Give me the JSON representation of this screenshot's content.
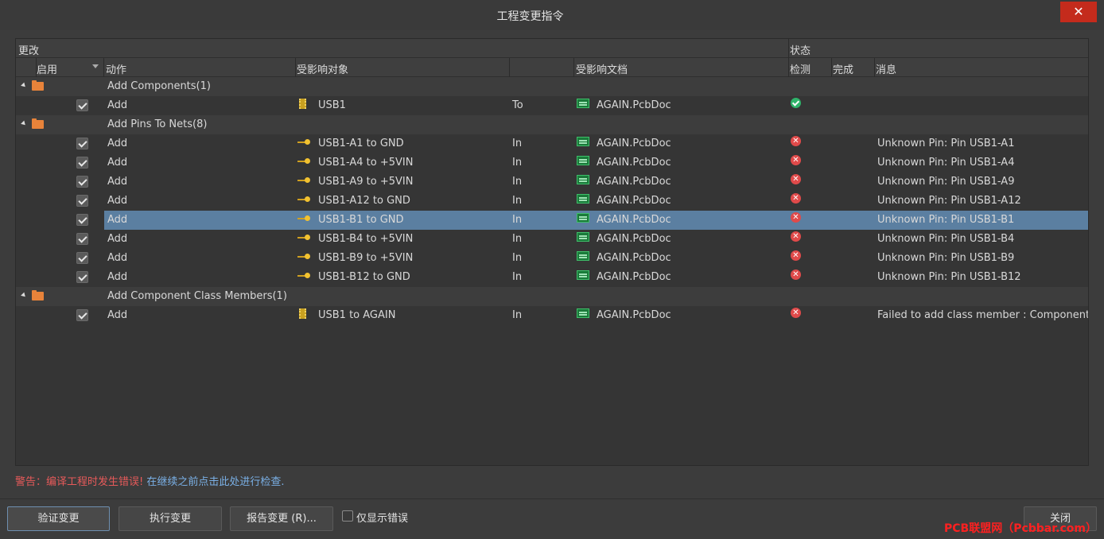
{
  "window": {
    "title": "工程变更指令",
    "close_label": "✕"
  },
  "grid": {
    "group_header": {
      "changes": "更改",
      "status": "状态"
    },
    "columns": {
      "enable": "启用",
      "action": "动作",
      "affected_object": "受影响对象",
      "affected_document": "受影响文档",
      "check": "检测",
      "done": "完成",
      "message": "消息"
    },
    "rows": [
      {
        "type": "group",
        "title": "Add Components(1)"
      },
      {
        "type": "item",
        "action": "Add",
        "object": "USB1",
        "dir": "To",
        "doc": "AGAIN.PcbDoc",
        "status": "ok",
        "message": "",
        "icon": "component-icon"
      },
      {
        "type": "group",
        "title": "Add Pins To Nets(8)"
      },
      {
        "type": "item",
        "action": "Add",
        "object": "USB1-A1 to GND",
        "dir": "In",
        "doc": "AGAIN.PcbDoc",
        "status": "error",
        "message": "Unknown Pin: Pin USB1-A1",
        "icon": "pin-icon"
      },
      {
        "type": "item",
        "action": "Add",
        "object": "USB1-A4 to +5VIN",
        "dir": "In",
        "doc": "AGAIN.PcbDoc",
        "status": "error",
        "message": "Unknown Pin: Pin USB1-A4",
        "icon": "pin-icon"
      },
      {
        "type": "item",
        "action": "Add",
        "object": "USB1-A9 to +5VIN",
        "dir": "In",
        "doc": "AGAIN.PcbDoc",
        "status": "error",
        "message": "Unknown Pin: Pin USB1-A9",
        "icon": "pin-icon"
      },
      {
        "type": "item",
        "action": "Add",
        "object": "USB1-A12 to GND",
        "dir": "In",
        "doc": "AGAIN.PcbDoc",
        "status": "error",
        "message": "Unknown Pin: Pin USB1-A12",
        "icon": "pin-icon"
      },
      {
        "type": "item",
        "action": "Add",
        "object": "USB1-B1 to GND",
        "dir": "In",
        "doc": "AGAIN.PcbDoc",
        "status": "error",
        "message": "Unknown Pin: Pin USB1-B1",
        "icon": "pin-icon",
        "selected": true
      },
      {
        "type": "item",
        "action": "Add",
        "object": "USB1-B4 to +5VIN",
        "dir": "In",
        "doc": "AGAIN.PcbDoc",
        "status": "error",
        "message": "Unknown Pin: Pin USB1-B4",
        "icon": "pin-icon"
      },
      {
        "type": "item",
        "action": "Add",
        "object": "USB1-B9 to +5VIN",
        "dir": "In",
        "doc": "AGAIN.PcbDoc",
        "status": "error",
        "message": "Unknown Pin: Pin USB1-B9",
        "icon": "pin-icon"
      },
      {
        "type": "item",
        "action": "Add",
        "object": "USB1-B12 to GND",
        "dir": "In",
        "doc": "AGAIN.PcbDoc",
        "status": "error",
        "message": "Unknown Pin: Pin USB1-B12",
        "icon": "pin-icon"
      },
      {
        "type": "group",
        "title": "Add Component Class Members(1)"
      },
      {
        "type": "item",
        "action": "Add",
        "object": "USB1 to AGAIN",
        "dir": "In",
        "doc": "AGAIN.PcbDoc",
        "status": "error",
        "message": "Failed to add class member : Component U",
        "icon": "component-icon"
      }
    ]
  },
  "warning": {
    "label": "警告：编译工程时发生错误!",
    "link": "在继续之前点击此处进行检查."
  },
  "buttons": {
    "validate": "验证变更",
    "execute": "执行变更",
    "report": "报告变更 (R)...",
    "only_errors": "仅显示错误",
    "close": "关闭"
  },
  "watermark": "PCB联盟网（Pcbbar.com）",
  "colors": {
    "selection": "#5b7fa1",
    "error": "#e04a4a",
    "ok": "#2fb36a",
    "warning_text": "#e65a5a",
    "link": "#7ab0e6"
  }
}
